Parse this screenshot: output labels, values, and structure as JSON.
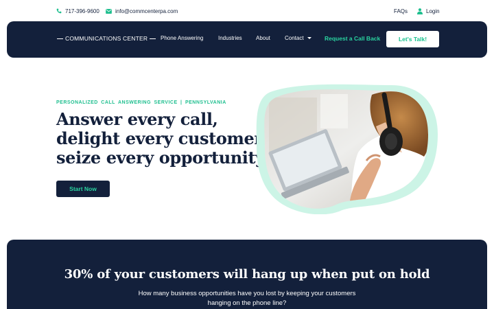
{
  "topbar": {
    "phone": "717-396-9600",
    "email": "info@commcenterpa.com",
    "faqs": "FAQs",
    "login": "Login",
    "icons": [
      "phone-icon",
      "mail-icon",
      "user-icon"
    ]
  },
  "nav": {
    "brand": "COMMUNICATIONS CENTER",
    "links": [
      "Phone Answering",
      "Industries",
      "About",
      "Contact"
    ],
    "callback": "Request a Call Back",
    "cta": "Let's Talk!"
  },
  "hero": {
    "eyebrow": "PERSONALIZED  CALL  ANSWERING  SERVICE  |  PENNSYLVANIA",
    "headline": [
      "Answer every call,",
      "delight every customer,",
      "seize every opportunity"
    ],
    "button": "Start Now"
  },
  "band": {
    "title": "30% of your customers will hang up when put on hold",
    "subtitle": "How many business opportunities have you lost by keeping your customers hanging on the phone line?"
  },
  "colors": {
    "navy": "#13203b",
    "accent": "#1fbf8f",
    "blob": "#ccf4e6"
  }
}
